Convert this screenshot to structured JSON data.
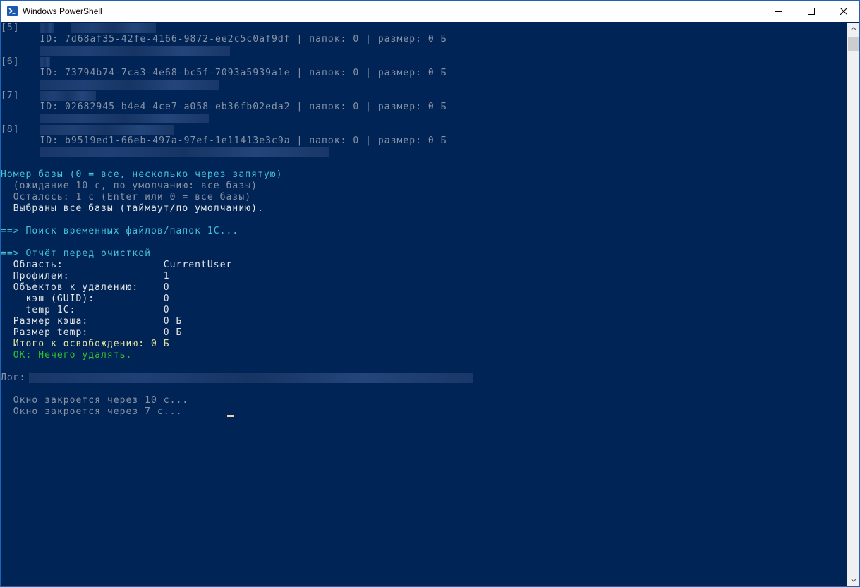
{
  "window": {
    "title": "Windows PowerShell"
  },
  "colors": {
    "console_bg": "#012456",
    "gray_text": "#8a93a4",
    "white_text": "#e6e6e6",
    "cyan_text": "#44c2d8",
    "yellow_text": "#e5e5a3",
    "green_text": "#2ec42e"
  },
  "icons": {
    "app": "powershell-icon",
    "minimize": "minimize-icon",
    "maximize": "maximize-icon",
    "close": "close-icon"
  },
  "console": {
    "bases": [
      {
        "num": "[5]",
        "id_line": "    ID: 7d68af35-42fe-4166-9872-ee2c5c0af9df | папок: 0 | размер: 0 Б"
      },
      {
        "num": "[6]",
        "id_line": "    ID: 73794b74-7ca3-4e68-bc5f-7093a5939a1e | папок: 0 | размер: 0 Б"
      },
      {
        "num": "[7]",
        "id_line": "    ID: 02682945-b4e4-4ce7-a058-eb36fb02eda2 | папок: 0 | размер: 0 Б"
      },
      {
        "num": "[8]",
        "id_line": "    ID: b9519ed1-66eb-497a-97ef-1e11413e3c9a | папок: 0 | размер: 0 Б"
      }
    ],
    "prompt": "Номер базы (0 = все, несколько через запятую)",
    "wait_line": "  (ожидание 10 с, по умолчанию: все базы)",
    "remaining_line": "  Осталось: 1 с (Enter или 0 = все базы)",
    "selected_line": "  Выбраны все базы (таймаут/по умолчанию).",
    "search_line": "==> Поиск временных файлов/папок 1С...",
    "report_header": "==> Отчёт перед очисткой",
    "report": {
      "scope": "  Область:                CurrentUser",
      "profiles": "  Профилей:               1",
      "objects": "  Объектов к удалению:    0",
      "cache_guid": "    кэш (GUID):           0",
      "temp_1c": "    temp 1C:              0",
      "cache_size": "  Размер кэша:            0 Б",
      "temp_size": "  Размер temp:            0 Б",
      "total": "  Итого к освобождению: 0 Б",
      "ok": "  OK: Нечего удалять."
    },
    "log_label": "Лог:",
    "close_line_1": "  Окно закроется через 10 с...",
    "close_line_2": "  Окно закроется через 7 с..."
  }
}
